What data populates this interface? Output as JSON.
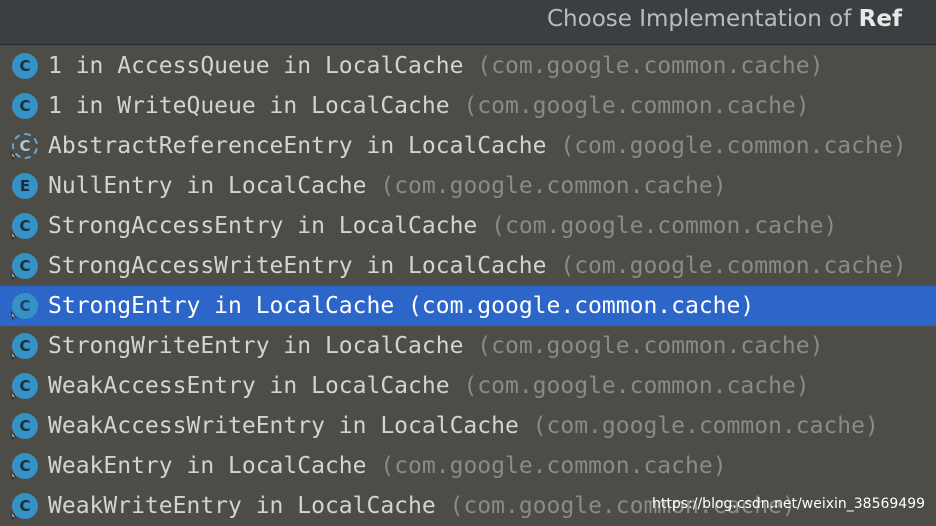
{
  "popup": {
    "title_prefix": "Choose Implementation of ",
    "title_bold": "Ref"
  },
  "items": [
    {
      "name": "1 in AccessQueue in LocalCache",
      "package": "(com.google.common.cache)",
      "icon": "class-icon",
      "badge": false,
      "selected": false
    },
    {
      "name": "1 in WriteQueue in LocalCache",
      "package": "(com.google.common.cache)",
      "icon": "class-icon",
      "badge": false,
      "selected": false
    },
    {
      "name": "AbstractReferenceEntry in LocalCache",
      "package": "(com.google.common.cache)",
      "icon": "abstract-class-icon",
      "badge": true,
      "selected": false
    },
    {
      "name": "NullEntry in LocalCache",
      "package": "(com.google.common.cache)",
      "icon": "enum-icon",
      "badge": false,
      "selected": false
    },
    {
      "name": "StrongAccessEntry in LocalCache",
      "package": "(com.google.common.cache)",
      "icon": "class-icon",
      "badge": true,
      "selected": false
    },
    {
      "name": "StrongAccessWriteEntry in LocalCache",
      "package": "(com.google.common.cache)",
      "icon": "class-icon",
      "badge": true,
      "selected": false
    },
    {
      "name": "StrongEntry in LocalCache",
      "package": "(com.google.common.cache)",
      "icon": "class-icon",
      "badge": true,
      "selected": true
    },
    {
      "name": "StrongWriteEntry in LocalCache",
      "package": "(com.google.common.cache)",
      "icon": "class-icon",
      "badge": true,
      "selected": false
    },
    {
      "name": "WeakAccessEntry in LocalCache",
      "package": "(com.google.common.cache)",
      "icon": "class-icon",
      "badge": true,
      "selected": false
    },
    {
      "name": "WeakAccessWriteEntry in LocalCache",
      "package": "(com.google.common.cache)",
      "icon": "class-icon",
      "badge": true,
      "selected": false
    },
    {
      "name": "WeakEntry in LocalCache",
      "package": "(com.google.common.cache)",
      "icon": "class-icon",
      "badge": true,
      "selected": false
    },
    {
      "name": "WeakWriteEntry in LocalCache",
      "package": "(com.google.common.cache)",
      "icon": "class-icon",
      "badge": true,
      "selected": false
    }
  ],
  "icon_letters": {
    "class-icon": "C",
    "abstract-class-icon": "C",
    "enum-icon": "E"
  },
  "watermark": "https://blog.csdn.net/weixin_38569499",
  "colors": {
    "background": "#4d4c47",
    "selection": "#2d66c9",
    "icon_blue": "#3592c4",
    "text": "#d4d4cd",
    "package_text": "#8b8b86"
  }
}
